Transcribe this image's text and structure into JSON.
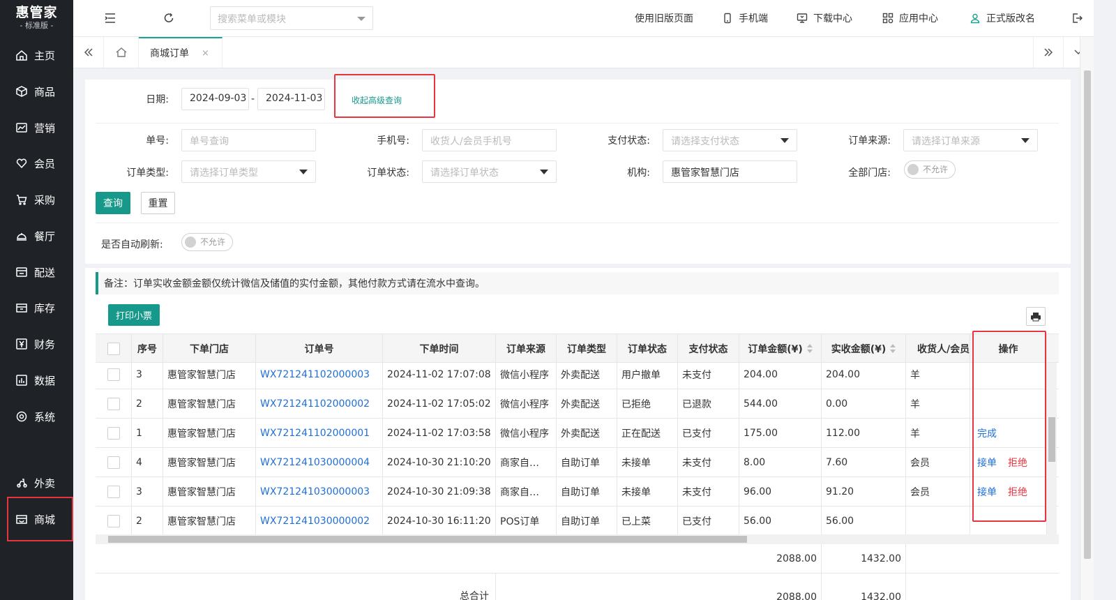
{
  "logo": {
    "brand": "惠管家",
    "edition": "标准版"
  },
  "sidebar": {
    "items": [
      {
        "label": "主页",
        "icon": "home-icon"
      },
      {
        "label": "商品",
        "icon": "box-icon"
      },
      {
        "label": "营销",
        "icon": "chart-icon"
      },
      {
        "label": "会员",
        "icon": "heart-icon"
      },
      {
        "label": "采购",
        "icon": "cart-icon"
      },
      {
        "label": "餐厅",
        "icon": "cloche-icon"
      },
      {
        "label": "配送",
        "icon": "delivery-icon"
      },
      {
        "label": "库存",
        "icon": "warehouse-icon"
      },
      {
        "label": "财务",
        "icon": "finance-icon"
      },
      {
        "label": "数据",
        "icon": "data-icon"
      },
      {
        "label": "系统",
        "icon": "settings-icon"
      },
      {
        "label": "外卖",
        "icon": "takeout-icon"
      },
      {
        "label": "商城",
        "icon": "store-icon"
      }
    ],
    "active": "商城"
  },
  "header": {
    "search_placeholder": "搜索菜单或模块",
    "links": {
      "old_page": "使用旧版页面",
      "mobile": "手机端",
      "download": "下载中心",
      "apps": "应用中心",
      "account": "正式版改名"
    }
  },
  "tabs": {
    "active": "商城订单",
    "close": "×"
  },
  "filters": {
    "date_label": "日期:",
    "date_start": "2024-09-03",
    "date_sep": "-",
    "date_end": "2024-11-03",
    "collapse_link": "收起高级查询",
    "order_no_label": "单号:",
    "order_no_placeholder": "单号查询",
    "phone_label": "手机号:",
    "phone_placeholder": "收货人/会员手机号",
    "pay_status_label": "支付状态:",
    "pay_status_placeholder": "请选择支付状态",
    "source_label": "订单来源:",
    "source_placeholder": "请选择订单来源",
    "type_label": "订单类型:",
    "type_placeholder": "请选择订单类型",
    "status_label": "订单状态:",
    "status_placeholder": "请选择订单状态",
    "org_label": "机构:",
    "org_value": "惠管家智慧门店",
    "all_stores_label": "全部门店:",
    "all_stores_toggle": "不允许",
    "query_button": "查询",
    "reset_button": "重置",
    "auto_refresh_label": "是否自动刷新:",
    "auto_refresh_toggle": "不允许"
  },
  "note": "备注：订单实收金额金额仅统计微信及储值的实付金额，其他付款方式请在流水中查询。",
  "print_button": "打印小票",
  "table": {
    "columns": [
      "序号",
      "下单门店",
      "订单号",
      "下单时间",
      "订单来源",
      "订单类型",
      "订单状态",
      "支付状态",
      "订单金额(¥)",
      "实收金额(¥)",
      "收货人/会员",
      "操作"
    ],
    "rows": [
      {
        "seq": "3",
        "store": "惠管家智慧门店",
        "order_no": "WX721241102000003",
        "time": "2024-11-02 17:07:08",
        "source": "微信小程序",
        "type": "外卖配送",
        "status": "用户撤单",
        "pay": "未支付",
        "amount": "204.00",
        "received": "204.00",
        "receiver": "羊",
        "act1": "",
        "act2": ""
      },
      {
        "seq": "2",
        "store": "惠管家智慧门店",
        "order_no": "WX721241102000002",
        "time": "2024-11-02 17:05:02",
        "source": "微信小程序",
        "type": "外卖配送",
        "status": "已拒绝",
        "pay": "已退款",
        "amount": "544.00",
        "received": "0.00",
        "receiver": "羊",
        "act1": "",
        "act2": ""
      },
      {
        "seq": "1",
        "store": "惠管家智慧门店",
        "order_no": "WX721241102000001",
        "time": "2024-11-02 17:03:58",
        "source": "微信小程序",
        "type": "外卖配送",
        "status": "正在配送",
        "pay": "已支付",
        "amount": "175.00",
        "received": "112.00",
        "receiver": "羊",
        "act1": "完成",
        "act2": ""
      },
      {
        "seq": "4",
        "store": "惠管家智慧门店",
        "order_no": "WX721241030000004",
        "time": "2024-10-30 21:10:20",
        "source": "商家自…",
        "type": "自助订单",
        "status": "未接单",
        "pay": "未支付",
        "amount": "8.00",
        "received": "7.60",
        "receiver": "会员",
        "act1": "接单",
        "act2": "拒绝"
      },
      {
        "seq": "3",
        "store": "惠管家智慧门店",
        "order_no": "WX721241030000003",
        "time": "2024-10-30 21:09:38",
        "source": "商家自…",
        "type": "自助订单",
        "status": "未接单",
        "pay": "未支付",
        "amount": "96.00",
        "received": "91.20",
        "receiver": "会员",
        "act1": "接单",
        "act2": "拒绝"
      },
      {
        "seq": "2",
        "store": "惠管家智慧门店",
        "order_no": "WX721241030000002",
        "time": "2024-10-30 16:11:20",
        "source": "POS订单",
        "type": "自助订单",
        "status": "已上菜",
        "pay": "已支付",
        "amount": "56.00",
        "received": "56.00",
        "receiver": "",
        "act1": "",
        "act2": ""
      }
    ],
    "page_total_amount": "2088.00",
    "page_total_received": "1432.00",
    "grand_label": "总合计",
    "grand_total_amount": "2088.00",
    "grand_total_received": "1432.00"
  },
  "colors": {
    "accent": "#16998a",
    "link": "#1e6fd9",
    "danger": "#e8343f",
    "sidebar": "#1f2226"
  }
}
